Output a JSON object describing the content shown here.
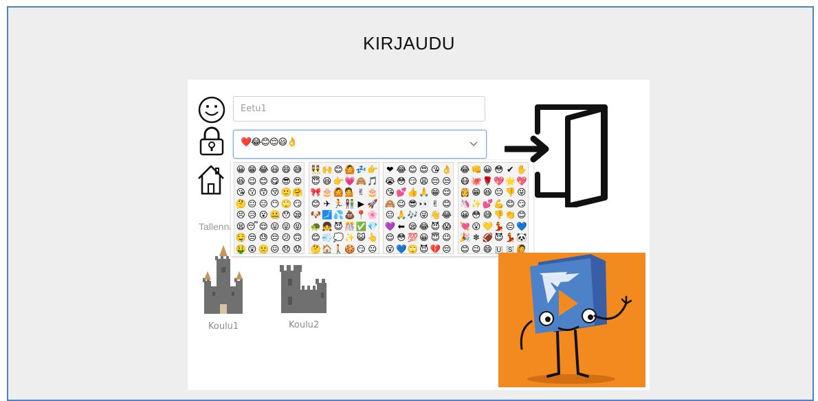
{
  "page": {
    "title": "KIRJAUDU"
  },
  "form": {
    "username_value": "Eetu1",
    "password_emojis": "❤️😂😊😌😃👌",
    "save_label": "Tallenna"
  },
  "emoji_picker": {
    "groups": [
      "😀😁😂😃😄😅😆😉😊😋😎😍😘😗😙😚🙂🤗🤔😐😑😶🙄😏😣😥😮🤐😯😪😫😴😌😛😜😝🤤😒😓😔😕🙃🤑😲🙁😖😞😟😤😢😭😦😧😨😩🤯😬😰😱😳🤪😵😡😠🤬😷🤒🤕",
      "👯🙌😊🙆💤👉😇😆👉💗🙈🎵🎀🎂🙆💁✌🎂😊✈🏃👫▶🚀🐶🗾💦💩📍🌸🐢👧😈🎊✅💎😊💨💭✨😺👆🤔🏠🚶🍪😏😐😐😐😐😐😐😐",
      "❤😂😊😍😘👌😭😳😏😩😔😒😘💕👍🙏😁😌🙈😉😎👀✌😊😐🙏🎶😜👋😂💜⬅😪😂😈😱😌😳💯😀😇😉😮💙🙄😈💔😔💙😌😋💚",
      "😂👊😀😳✔✋😷🐙🌹💖🌟💖👸😁😆😐👎😜🦄✨💕💪😊😏😀😳😅👎👏😊💘😮💛💃😑💙🎉❄🏈😈💃🐼😊😉😄🇺🇸🙋"
    ]
  },
  "schools": [
    {
      "label": "Koulu1"
    },
    {
      "label": "Koulu2"
    }
  ],
  "colors": {
    "frame_border": "#4f84c4",
    "frame_bg": "#eeeeee",
    "select_focus": "#74a9d8",
    "mascot_bg": "#f28a1f",
    "mascot_body": "#4a7cc2"
  }
}
